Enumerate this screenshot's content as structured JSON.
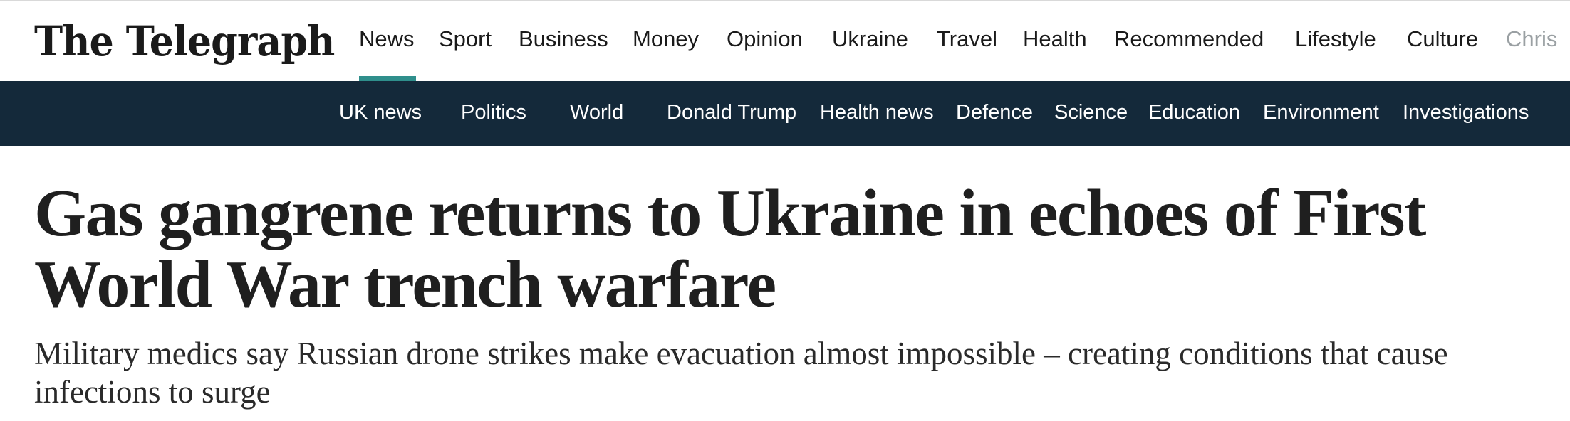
{
  "brand": {
    "logo_text": "The Telegraph"
  },
  "primary_nav": {
    "active": "News",
    "items": [
      "News",
      "Sport",
      "Business",
      "Money",
      "Opinion",
      "Ukraine",
      "Travel",
      "Health",
      "Recommended",
      "Lifestyle",
      "Culture",
      "Chris"
    ]
  },
  "secondary_nav": {
    "items": [
      "UK news",
      "Politics",
      "World",
      "Donald Trump",
      "Health news",
      "Defence",
      "Science",
      "Education",
      "Environment",
      "Investigations"
    ]
  },
  "article": {
    "headline": "Gas gangrene returns to Ukraine in echoes of First World War trench warfare",
    "standfirst": "Military medics say Russian drone strikes make evacuation almost impossible – creating conditions that cause infections to surge"
  },
  "colors": {
    "accent": "#2f8f8c",
    "subnav_background": "#14293a"
  }
}
